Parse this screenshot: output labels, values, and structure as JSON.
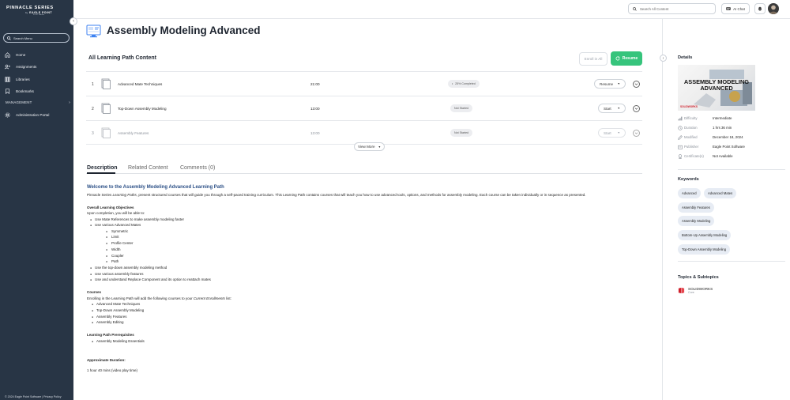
{
  "sidebar": {
    "logo_top": "PINNACLE SERIES",
    "logo_by": "by",
    "logo_company": "EAGLE POINT",
    "logo_sub": "SOFTWARE",
    "search_label": "Search Menu",
    "items": [
      {
        "label": "Home",
        "icon": "home-icon"
      },
      {
        "label": "Assignments",
        "icon": "assignments-icon"
      },
      {
        "label": "Libraries",
        "icon": "libraries-icon"
      },
      {
        "label": "Bookmarks",
        "icon": "bookmark-icon"
      }
    ],
    "section_label": "MANAGEMENT",
    "admin_label": "Administration Portal",
    "copyright": "© 2024 Eagle Point Software | Privacy Policy"
  },
  "header": {
    "search_placeholder": "Search All Content",
    "ai_chat_label": "AI Chat"
  },
  "page": {
    "title": "Assembly Modeling Advanced"
  },
  "content": {
    "section_title": "All Learning Path Content",
    "enroll_label": "Enroll in All",
    "resume_label": "Resume",
    "courses": [
      {
        "num": "1",
        "name": "Advanced Mate Techniques",
        "time": "21:00",
        "status": "25% Completed",
        "action": "Resume"
      },
      {
        "num": "2",
        "name": "Top-Down Assembly Modeling",
        "time": "13:00",
        "status": "Not Started",
        "action": "Start"
      },
      {
        "num": "3",
        "name": "Assembly Features",
        "time": "13:00",
        "status": "Not Started",
        "action": "Start"
      }
    ],
    "view_more_label": "View More"
  },
  "tabs": [
    {
      "label": "Description"
    },
    {
      "label": "Related Content"
    },
    {
      "label": "Comments (0)"
    }
  ],
  "description": {
    "heading": "Welcome to the Assembly Modeling Advanced Learning Path",
    "intro_prefix": "Pinnacle Series ",
    "intro_italic": "Learning Paths",
    "intro_rest": ", present structured courses that will guide you through a self-paced training curriculum. This Learning Path contains courses that will teach you how to use advanced tools, options, and methods for assembly modeling. Each course can be taken individually or in sequence as presented.",
    "objectives_heading": "Overall Learning Objectives",
    "objectives_intro": "Upon completion, you will be able to:",
    "obj_1": "Use Mate References to make assembly modeling faster",
    "obj_2": "Use various Advanced Mates",
    "sub_items": [
      "Symmetric",
      "Limit",
      "Profile Center",
      "Width",
      "Coupler",
      "Path"
    ],
    "obj_3": "Use the top-down assembly modeling method",
    "obj_4": "Use various assembly features",
    "obj_5": "Use and understand Replace Component and its option to reattach mates",
    "courses_heading": "Courses",
    "courses_intro_prefix": "Enrolling in the Learning Path will add the following courses to your ",
    "courses_intro_italic": "Current Enrollments",
    "courses_intro_suffix": " list:",
    "course_list": [
      "Advanced Mate Techniques",
      "Top-Down Assembly Modeling",
      "Assembly Features",
      "Assembly Editing"
    ],
    "prereq_heading": "Learning Path Prerequisites",
    "prereq_item": "Assembly Modeling Essentials",
    "duration_heading": "Approximate Duration:",
    "duration_value": "1 hour 40 mins (video play time)"
  },
  "details": {
    "heading": "Details",
    "thumb_title_1": "ASSEMBLY MODELING",
    "thumb_title_2": "ADVANCED",
    "thumb_brand": "SOLIDWORKS",
    "rows": [
      {
        "label": "Difficulty",
        "value": "Intermediate",
        "icon": "difficulty-icon"
      },
      {
        "label": "Duration",
        "value": "1 hrs 36 min",
        "icon": "clock-icon"
      },
      {
        "label": "Modified",
        "value": "December 18, 2024",
        "icon": "pencil-icon"
      },
      {
        "label": "Publisher",
        "value": "Eagle Point Software",
        "icon": "publisher-icon"
      },
      {
        "label": "Certificate(s)",
        "value": "Not Available",
        "icon": "certificate-icon"
      }
    ]
  },
  "keywords": {
    "heading": "Keywords",
    "items": [
      "Advanced",
      "Advanced Mates",
      "Assembly Features",
      "Assembly Modeling",
      "Bottom-Up Assembly Modeling",
      "Top-Down Assembly Modeling"
    ]
  },
  "topics": {
    "heading": "Topics & Subtopics",
    "name": "SOLIDWORKS",
    "sub": "Core"
  },
  "colors": {
    "sidebar_bg": "#283545",
    "accent_blue": "#3d82f2",
    "resume_green": "#36c47c",
    "keyword_bg": "#e7ecf4",
    "heading_blue": "#2b4f86"
  }
}
